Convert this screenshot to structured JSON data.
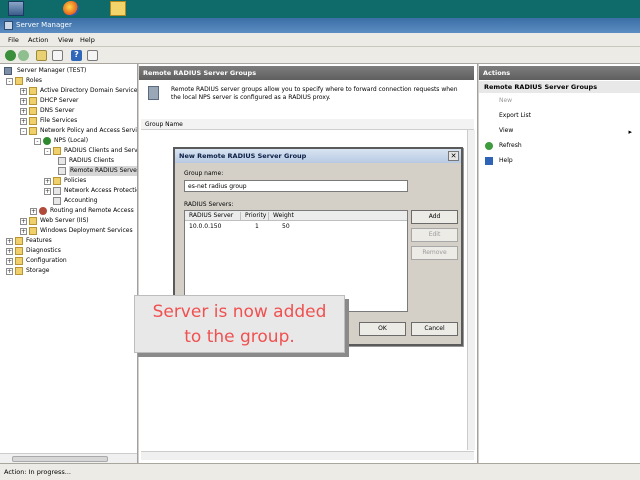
{
  "window": {
    "title": "Server Manager"
  },
  "menu": [
    "File",
    "Action",
    "View",
    "Help"
  ],
  "tree": {
    "items": [
      "Server Manager (TEST)",
      "Roles",
      "Active Directory Domain Services",
      "DHCP Server",
      "DNS Server",
      "File Services",
      "Network Policy and Access Services",
      "NPS (Local)",
      "RADIUS Clients and Servers",
      "RADIUS Clients",
      "Remote RADIUS Server Groups",
      "Policies",
      "Network Access Protection",
      "Accounting",
      "Routing and Remote Access",
      "Web Server (IIS)",
      "Windows Deployment Services",
      "Features",
      "Diagnostics",
      "Configuration",
      "Storage"
    ]
  },
  "center": {
    "header": "Remote RADIUS Server Groups",
    "description": "Remote RADIUS server groups allow you to specify where to forward connection requests when the local NPS server is configured as a RADIUS proxy.",
    "column": "Group Name"
  },
  "actions": {
    "header": "Actions",
    "subheader": "Remote RADIUS Server Groups",
    "items": [
      "New",
      "Export List",
      "View",
      "Refresh",
      "Help"
    ]
  },
  "dialog": {
    "title": "New Remote RADIUS Server Group",
    "group_label": "Group name:",
    "group_value": "es-net radius group",
    "servers_label": "RADIUS Servers:",
    "columns": [
      "RADIUS Server",
      "Priority",
      "Weight"
    ],
    "rows": [
      {
        "server": "10.0.0.150",
        "priority": "1",
        "weight": "50"
      }
    ],
    "buttons": {
      "add": "Add",
      "edit": "Edit",
      "remove": "Remove",
      "ok": "OK",
      "cancel": "Cancel"
    }
  },
  "status": "Action:  In progress...",
  "callout": {
    "line1": "Server is now added",
    "line2": "to the group."
  }
}
